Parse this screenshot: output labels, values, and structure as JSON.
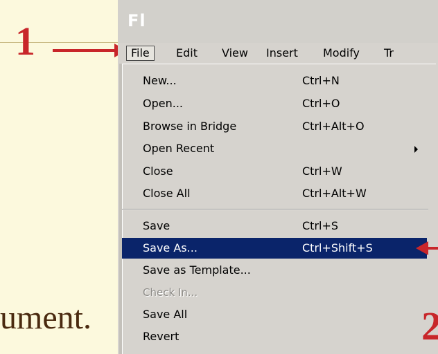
{
  "annotations": {
    "step1": "1",
    "step2": "2",
    "background_text": "ument."
  },
  "app": {
    "logo": "Fl"
  },
  "menubar": {
    "items": [
      "File",
      "Edit",
      "View",
      "Insert",
      "Modify",
      "Tr"
    ]
  },
  "file_menu": {
    "items": [
      {
        "label": "New...",
        "shortcut": "Ctrl+N"
      },
      {
        "label": "Open...",
        "shortcut": "Ctrl+O"
      },
      {
        "label": "Browse in Bridge",
        "shortcut": "Ctrl+Alt+O"
      },
      {
        "label": "Open Recent",
        "shortcut": ""
      },
      {
        "label": "Close",
        "shortcut": "Ctrl+W"
      },
      {
        "label": "Close All",
        "shortcut": "Ctrl+Alt+W"
      },
      {
        "label": "Save",
        "shortcut": "Ctrl+S"
      },
      {
        "label": "Save As...",
        "shortcut": "Ctrl+Shift+S"
      },
      {
        "label": "Save as Template...",
        "shortcut": ""
      },
      {
        "label": "Check In...",
        "shortcut": ""
      },
      {
        "label": "Save All",
        "shortcut": ""
      },
      {
        "label": "Revert",
        "shortcut": ""
      }
    ]
  },
  "colors": {
    "slide_background": "#fcf9dd",
    "annotation_red": "#c8262a",
    "highlight": "#0a246a",
    "menu_background": "#d6d3ce"
  }
}
